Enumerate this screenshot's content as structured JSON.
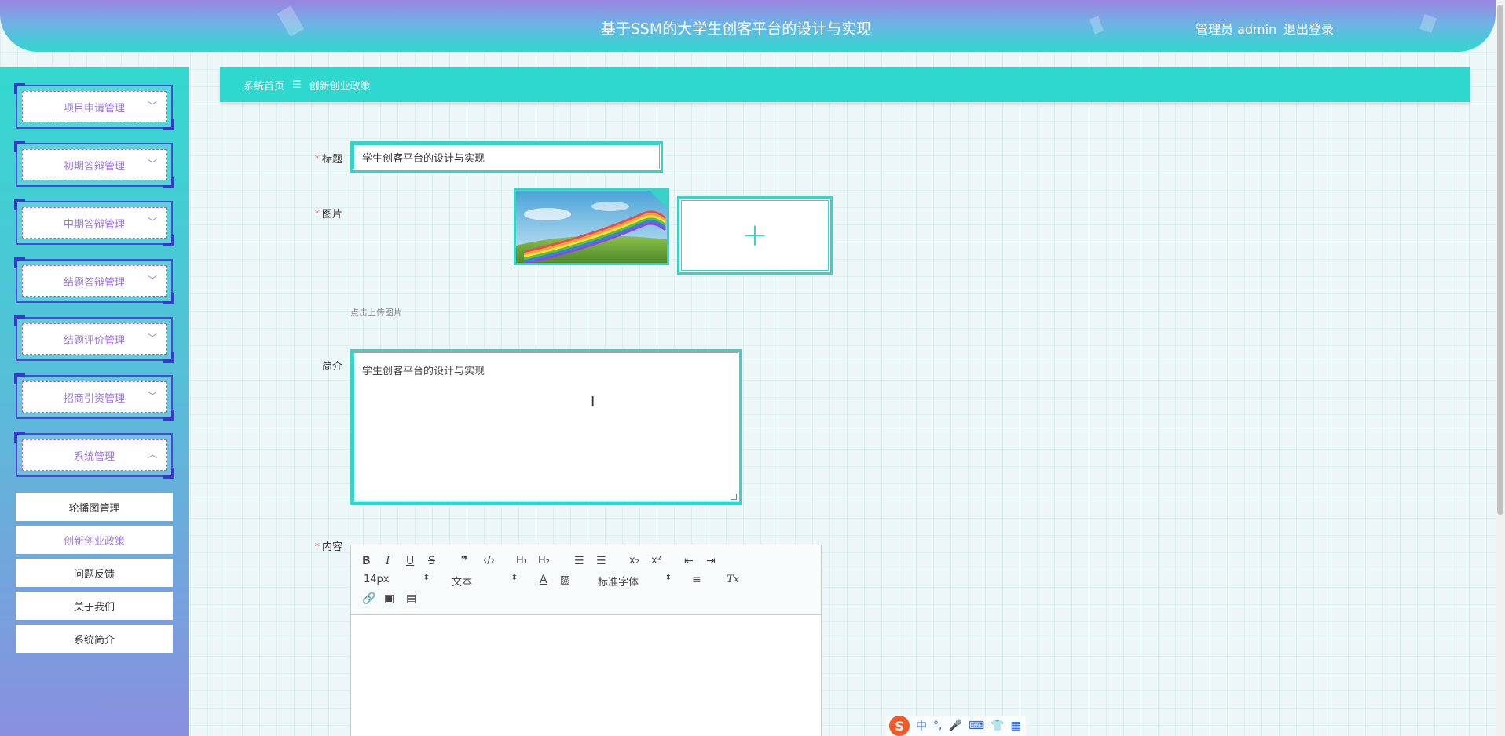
{
  "header": {
    "title": "基于SSM的大学生创客平台的设计与实现",
    "user": "管理员 admin",
    "logout": "退出登录"
  },
  "sidebar": {
    "groups": [
      {
        "label": "项目申请管理",
        "chevron": "chevron-down-icon"
      },
      {
        "label": "初期答辩管理",
        "chevron": "chevron-down-icon"
      },
      {
        "label": "中期答辩管理",
        "chevron": "chevron-down-icon"
      },
      {
        "label": "结题答辩管理",
        "chevron": "chevron-down-icon"
      },
      {
        "label": "结题评价管理",
        "chevron": "chevron-down-icon"
      },
      {
        "label": "招商引资管理",
        "chevron": "chevron-down-icon"
      },
      {
        "label": "系统管理",
        "chevron": "chevron-up-icon"
      }
    ],
    "sub_items": [
      {
        "label": "轮播图管理",
        "active": false
      },
      {
        "label": "创新创业政策",
        "active": true
      },
      {
        "label": "问题反馈",
        "active": false
      },
      {
        "label": "关于我们",
        "active": false
      },
      {
        "label": "系统简介",
        "active": false
      }
    ]
  },
  "breadcrumb": {
    "home": "系统首页",
    "separator": "☰",
    "current": "创新创业政策"
  },
  "form": {
    "title_label": "标题",
    "title_value": "学生创客平台的设计与实现",
    "image_label": "图片",
    "upload_hint": "点击上传图片",
    "intro_label": "简介",
    "intro_value": "学生创客平台的设计与实现",
    "content_label": "内容",
    "required_mark": "*"
  },
  "editor": {
    "font_size": "14px",
    "header_select": "文本",
    "font_family": "标准字体",
    "buttons": {
      "bold": "B",
      "italic": "I",
      "underline": "U",
      "strike": "S",
      "h1": "H₁",
      "h2": "H₂",
      "sub": "x₂",
      "sup": "x²",
      "clear": "Tx"
    }
  },
  "ime": {
    "logo": "S",
    "lang": "中",
    "punct": "°,"
  },
  "colors": {
    "accent": "#2ed8cf",
    "menu_text": "#9a78d8",
    "required": "#f56c6c"
  }
}
